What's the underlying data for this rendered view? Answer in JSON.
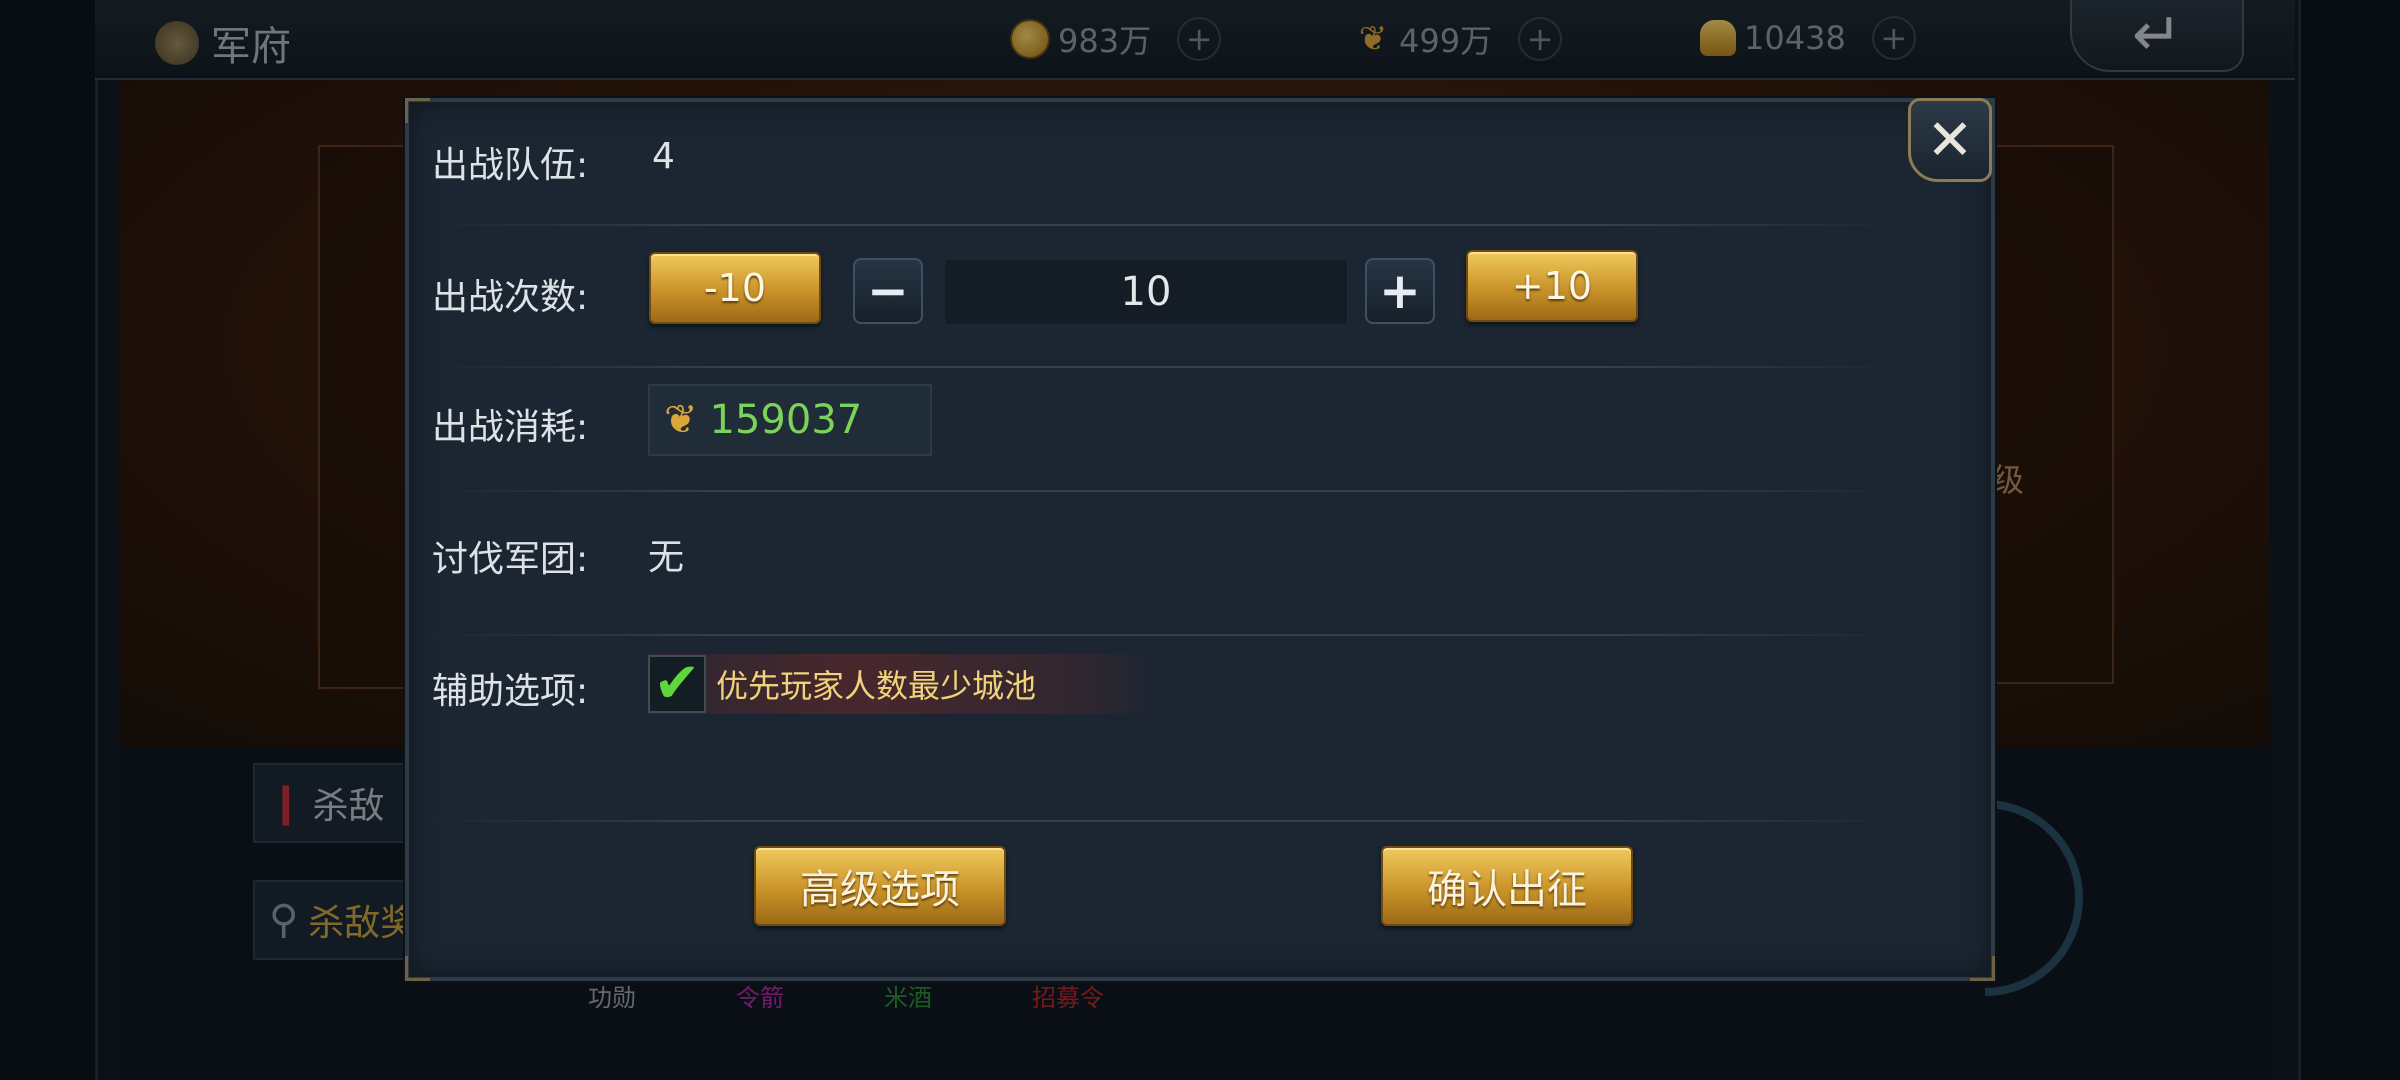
{
  "top_bar": {
    "title": "军府",
    "resources": [
      {
        "icon": "coin-icon",
        "value": "983万"
      },
      {
        "icon": "grain-icon",
        "value": "499万"
      },
      {
        "icon": "ingot-icon",
        "value": "10438"
      }
    ],
    "plus_glyph": "+",
    "back_icon": "return-arrow-icon"
  },
  "background": {
    "right_fragment": "级",
    "kill_button_label": "杀敌",
    "search_button_label": "杀敌奖",
    "tabs": [
      "功勋",
      "令箭",
      "米酒",
      "招募令"
    ]
  },
  "dialog": {
    "close_glyph": "✕",
    "rows": {
      "team_label": "出战队伍:",
      "team_value": "4",
      "times_label": "出战次数:",
      "minus10": "-10",
      "minus_glyph": "−",
      "times_value": "10",
      "plus_glyph": "+",
      "plus10": "+10",
      "cost_label": "出战消耗:",
      "cost_value": "159037",
      "legion_label": "讨伐军团:",
      "legion_value": "无",
      "assist_label": "辅助选项:",
      "assist_option": "优先玩家人数最少城池",
      "assist_checked": true
    },
    "buttons": {
      "advanced": "高级选项",
      "confirm": "确认出征"
    }
  },
  "colors": {
    "cost_value": "#7cd35a",
    "assist_text": "#f0d27a",
    "button_gold": "#c9932a"
  }
}
